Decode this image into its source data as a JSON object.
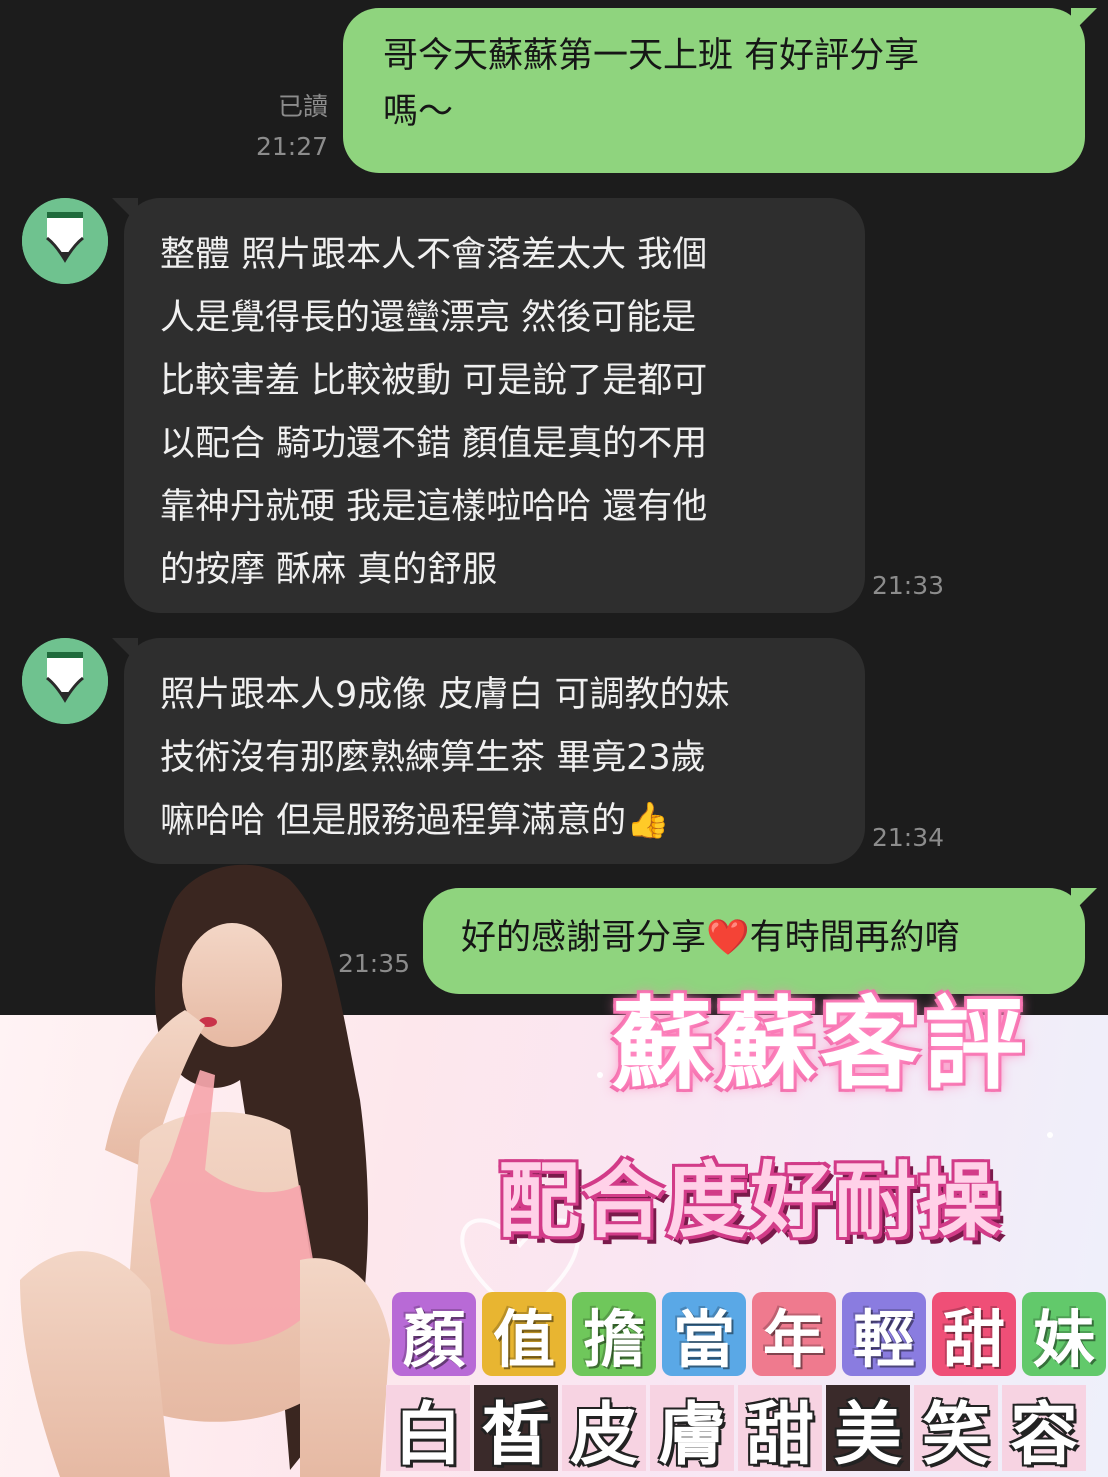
{
  "messages": [
    {
      "id": "m1",
      "direction": "outgoing",
      "text_lines": [
        "哥今天蘇蘇第一天上班 有好評分享",
        "嗎～"
      ],
      "read_label": "已讀",
      "time": "21:27"
    },
    {
      "id": "m2",
      "direction": "incoming",
      "text_lines": [
        "整體 照片跟本人不會落差太大 我個",
        "人是覺得長的還蠻漂亮  然後可能是",
        "比較害羞 比較被動 可是說了是都可",
        "以配合 騎功還不錯 顏值是真的不用",
        "靠神丹就硬 我是這樣啦哈哈 還有他",
        "的按摩 酥麻 真的舒服"
      ],
      "time": "21:33"
    },
    {
      "id": "m3",
      "direction": "incoming",
      "text_lines": [
        "照片跟本人9成像 皮膚白 可調教的妹",
        "技術沒有那麼熟練算生茶 畢竟23歲",
        "嘛哈哈 但是服務過程算滿意的👍"
      ],
      "time": "21:34"
    },
    {
      "id": "m4",
      "direction": "outgoing",
      "text_lines": [
        "好的感謝哥分享❤️有時間再約唷"
      ],
      "time": "21:35"
    }
  ],
  "promo": {
    "title": "蘇蘇客評",
    "subtitle": "配合度好耐操",
    "line1": [
      "顏",
      "值",
      "擔",
      "當",
      "年",
      "輕",
      "甜",
      "妹"
    ],
    "line2": [
      "白",
      "皙",
      "皮",
      "膚",
      "甜",
      "美",
      "笑",
      "容"
    ]
  },
  "colors": {
    "chat_bg": "#1c1c1c",
    "bubble_out": "#8fd47e",
    "bubble_in": "#2e2e2e",
    "avatar": "#6fc28f",
    "tiles_line1": [
      "#b86ad6",
      "#e8b531",
      "#6fc75b",
      "#5aa8e6",
      "#ef7a8e",
      "#8a7ce0",
      "#ef4f77",
      "#62c96b"
    ],
    "tiles_line2": [
      "#f7d3e2",
      "#3a2a2a",
      "#f7d3e2",
      "#f7d3e2",
      "#f7d3e2",
      "#3a2a2a",
      "#f7d3e2",
      "#f7d3e2"
    ]
  },
  "icons": {
    "avatar": "pencil-avatar-icon",
    "thumbs": "thumbs-up-emoji",
    "heart": "red-heart-emoji"
  }
}
